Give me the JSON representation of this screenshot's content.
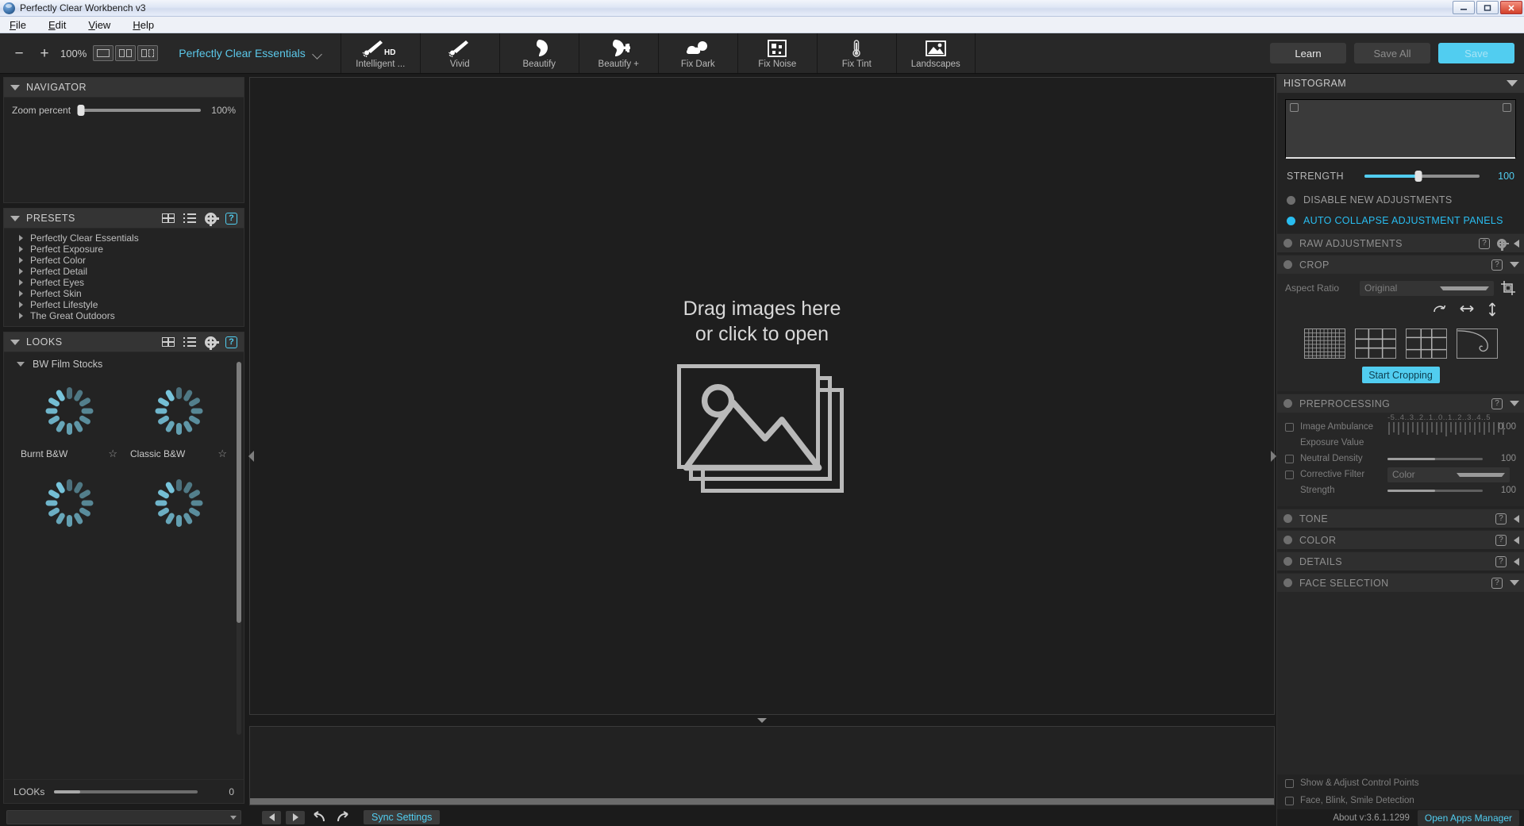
{
  "window": {
    "title": "Perfectly Clear Workbench v3",
    "icon": "app-icon",
    "buttons": {
      "minimize": "–",
      "maximize": "□",
      "close": "✕"
    }
  },
  "menu": {
    "items": [
      "File",
      "Edit",
      "View",
      "Help"
    ]
  },
  "toolbar": {
    "zoom_out": "−",
    "zoom_in": "+",
    "zoom_value": "100%",
    "view_modes": [
      "single-view",
      "split-view",
      "compare-view"
    ],
    "preset_selector": "Perfectly Clear Essentials",
    "tools": [
      {
        "label": "Intelligent ...",
        "icon": "brush-hd-icon"
      },
      {
        "label": "Vivid",
        "icon": "brush-icon"
      },
      {
        "label": "Beautify",
        "icon": "face-icon"
      },
      {
        "label": "Beautify +",
        "icon": "face-plus-icon"
      },
      {
        "label": "Fix Dark",
        "icon": "cloud-icon"
      },
      {
        "label": "Fix Noise",
        "icon": "noise-icon"
      },
      {
        "label": "Fix Tint",
        "icon": "thermometer-icon"
      },
      {
        "label": "Landscapes",
        "icon": "landscape-icon"
      }
    ],
    "learn": "Learn",
    "save_all": "Save All",
    "save": "Save"
  },
  "left": {
    "navigator": {
      "title": "NAVIGATOR",
      "slider_label": "Zoom percent",
      "slider_value": "100%"
    },
    "presets": {
      "title": "PRESETS",
      "items": [
        "Perfectly Clear Essentials",
        "Perfect Exposure",
        "Perfect Color",
        "Perfect Detail",
        "Perfect Eyes",
        "Perfect Skin",
        "Perfect Lifestyle",
        "The Great Outdoors"
      ]
    },
    "looks": {
      "title": "LOOKS",
      "group": "BW Film Stocks",
      "items": [
        {
          "name": "Burnt B&W",
          "favorite": "☆"
        },
        {
          "name": "Classic B&W",
          "favorite": "☆"
        },
        {
          "name": "",
          "favorite": ""
        },
        {
          "name": "",
          "favorite": ""
        }
      ],
      "slider_label": "LOOKs",
      "slider_value": "0"
    }
  },
  "center": {
    "drop_line1": "Drag images here",
    "drop_line2": "or click to open",
    "sync_settings": "Sync Settings",
    "prev": "prev-image",
    "next": "next-image",
    "undo": "undo",
    "redo": "redo"
  },
  "right": {
    "histogram": {
      "title": "HISTOGRAM"
    },
    "strength": {
      "label": "STRENGTH",
      "value": "100"
    },
    "options": [
      {
        "label": "DISABLE NEW ADJUSTMENTS",
        "active": false
      },
      {
        "label": "AUTO COLLAPSE ADJUSTMENT PANELS",
        "active": true
      }
    ],
    "sections": [
      {
        "title": "RAW ADJUSTMENTS",
        "collapsed": true,
        "has_gear": true
      },
      {
        "title": "CROP",
        "collapsed": false,
        "has_gear": false
      },
      {
        "title": "PREPROCESSING",
        "collapsed": false,
        "has_gear": false
      },
      {
        "title": "TONE",
        "collapsed": true,
        "has_gear": false
      },
      {
        "title": "COLOR",
        "collapsed": true,
        "has_gear": false
      },
      {
        "title": "DETAILS",
        "collapsed": true,
        "has_gear": false
      },
      {
        "title": "FACE SELECTION",
        "collapsed": false,
        "has_gear": false
      }
    ],
    "crop": {
      "aspect_label": "Aspect Ratio",
      "aspect_value": "Original",
      "rotate": "rotate-icon",
      "flip_h": "flip-horizontal-icon",
      "flip_v": "flip-vertical-icon",
      "overlays": [
        "fine-grid",
        "thirds-grid",
        "thirds-grid-alt",
        "golden-spiral"
      ],
      "start_button": "Start Cropping"
    },
    "preprocessing": {
      "image_ambulance": "Image Ambulance",
      "exposure_value": "Exposure Value",
      "exposure_ticks": "-5..4..3..2..1..0..1..2..3..4..5",
      "exposure_number": "0.00",
      "neutral_density": "Neutral Density",
      "neutral_density_value": "100",
      "corrective_filter": "Corrective Filter",
      "corrective_filter_value": "Color",
      "strength": "Strength",
      "strength_value": "100"
    },
    "face_options": [
      "Show & Adjust Control Points",
      "Face, Blink, Smile Detection"
    ],
    "status": {
      "about": "About v:3.6.1.1299",
      "apps_manager": "Open Apps Manager"
    }
  },
  "colors": {
    "accent": "#51cdf0",
    "panel": "#232323",
    "header": "#343434",
    "bg": "#1b1b1b"
  }
}
